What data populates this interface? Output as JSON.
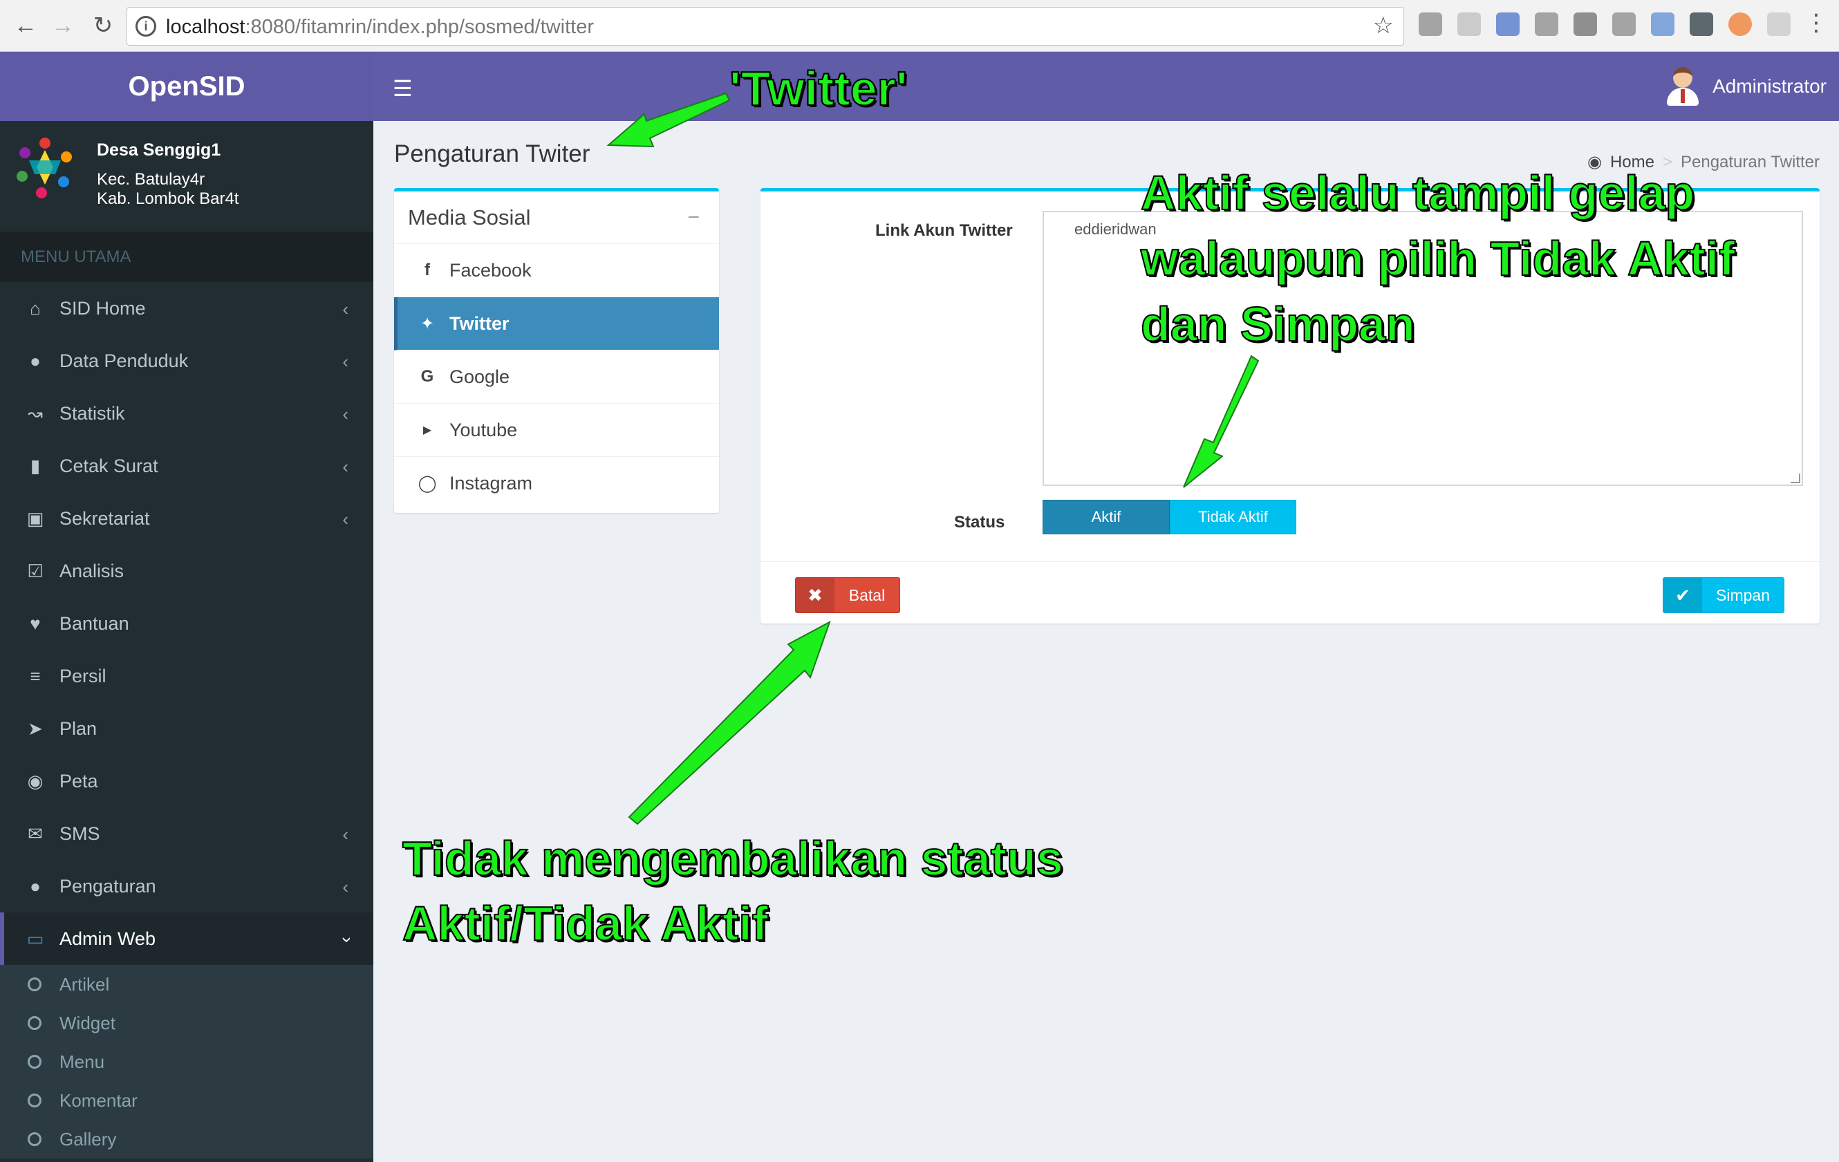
{
  "browser": {
    "url_host": "localhost",
    "url_rest": ":8080/fitamrin/index.php/sosmed/twitter"
  },
  "app": {
    "brand": "OpenSID"
  },
  "user": {
    "name": "Administrator"
  },
  "village": {
    "name": "Desa Senggig1",
    "kecamatan": "Kec. Batulay4r",
    "kabupaten": "Kab. Lombok Bar4t"
  },
  "sidebar": {
    "header": "MENU UTAMA",
    "items": [
      {
        "label": "SID Home",
        "icon": "home-icon",
        "chevron": true
      },
      {
        "label": "Data Penduduk",
        "icon": "users-icon",
        "chevron": true
      },
      {
        "label": "Statistik",
        "icon": "line-chart-icon",
        "chevron": true
      },
      {
        "label": "Cetak Surat",
        "icon": "book-icon",
        "chevron": true
      },
      {
        "label": "Sekretariat",
        "icon": "archive-icon",
        "chevron": true
      },
      {
        "label": "Analisis",
        "icon": "check-square-icon",
        "chevron": false
      },
      {
        "label": "Bantuan",
        "icon": "heart-icon",
        "chevron": false
      },
      {
        "label": "Persil",
        "icon": "map-signs-icon",
        "chevron": false
      },
      {
        "label": "Plan",
        "icon": "location-arrow-icon",
        "chevron": false
      },
      {
        "label": "Peta",
        "icon": "globe-icon",
        "chevron": false
      },
      {
        "label": "SMS",
        "icon": "envelope-icon",
        "chevron": true
      },
      {
        "label": "Pengaturan",
        "icon": "users-icon",
        "chevron": true
      },
      {
        "label": "Admin Web",
        "icon": "desktop-icon",
        "chevron": true,
        "active": true
      }
    ],
    "submenu": [
      "Artikel",
      "Widget",
      "Menu",
      "Komentar",
      "Gallery"
    ]
  },
  "page": {
    "title": "Pengaturan Twiter",
    "breadcrumb": {
      "home": "Home",
      "separator": ">",
      "current": "Pengaturan Twitter"
    }
  },
  "social_box": {
    "title": "Media Sosial",
    "collapse": "−",
    "items": [
      {
        "label": "Facebook",
        "icon": "facebook-icon"
      },
      {
        "label": "Twitter",
        "icon": "twitter-icon",
        "active": true
      },
      {
        "label": "Google",
        "icon": "google-icon"
      },
      {
        "label": "Youtube",
        "icon": "youtube-icon"
      },
      {
        "label": "Instagram",
        "icon": "instagram-icon"
      }
    ]
  },
  "form": {
    "link_label": "Link Akun Twitter",
    "link_value": "eddieridwan",
    "status_label": "Status",
    "status_options": [
      "Aktif",
      "Tidak Aktif"
    ],
    "cancel_label": "Batal",
    "save_label": "Simpan"
  },
  "annotations": {
    "twitter": "'Twitter'",
    "aktif_lines": [
      "Aktif selalu tampil gelap",
      "walaupun pilih Tidak Aktif",
      "dan Simpan"
    ],
    "tidak_lines": [
      "Tidak mengembalikan status",
      "Aktif/Tidak Aktif"
    ]
  },
  "colors": {
    "brand_purple": "#605ca8",
    "sidebar_bg": "#222d32",
    "active_blue": "#3c8dbc",
    "info": "#00c0ef",
    "danger": "#dd4b39",
    "annotation_green": "#1cef1c"
  }
}
